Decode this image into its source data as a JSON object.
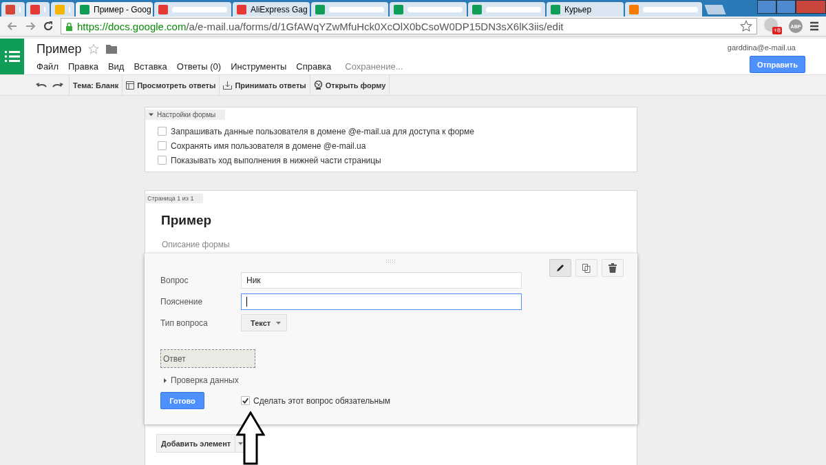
{
  "browser": {
    "tabs": [
      {
        "kind": "gmail",
        "selected": false
      },
      {
        "kind": "red",
        "selected": false
      },
      {
        "kind": "drive",
        "selected": false
      },
      {
        "kind": "forms",
        "title": "Пример - Goog",
        "selected": true
      },
      {
        "kind": "cart",
        "selected": false
      },
      {
        "kind": "cart",
        "title": "AliExpress Gag",
        "selected": false
      },
      {
        "kind": "sheets",
        "selected": false
      },
      {
        "kind": "sheets",
        "selected": false
      },
      {
        "kind": "sheets",
        "selected": false
      },
      {
        "kind": "sheets",
        "title": "Курьер",
        "selected": false
      },
      {
        "kind": "orange",
        "selected": false
      }
    ],
    "url_host": "https://docs.google.com",
    "url_path": "/a/e-mail.ua/forms/d/1GfAWqYZwMfuHck0XcOlX0bCsoW0DP15DN3sX6lK3iis/edit",
    "badge": "+8",
    "abp": "ABP"
  },
  "doc": {
    "title": "Пример",
    "starred": false,
    "account": "garddina@e-mail.ua",
    "send_button": "Отправить",
    "menu": [
      "Файл",
      "Правка",
      "Вид",
      "Вставка",
      "Ответы (0)",
      "Инструменты",
      "Справка"
    ],
    "save_status": "Сохранение..."
  },
  "toolbar": [
    {
      "kind": "theme",
      "label": "Тема: Бланк"
    },
    {
      "kind": "table",
      "label": "Просмотреть ответы"
    },
    {
      "kind": "download",
      "label": "Принимать ответы"
    },
    {
      "kind": "globe",
      "label": "Открыть форму"
    }
  ],
  "settings": {
    "title": "Настройки формы",
    "expanded": true,
    "options": [
      {
        "label": "Запрашивать данные пользователя в домене @e-mail.ua для доступа к форме",
        "checked": false
      },
      {
        "label": "Сохранять имя пользователя в домене @e-mail.ua",
        "checked": false
      },
      {
        "label": "Показывать ход выполнения в нижней части страницы",
        "checked": false
      }
    ]
  },
  "page": {
    "tab": "Страница 1 из 1",
    "title": "Пример",
    "description": "Описание формы"
  },
  "question": {
    "label_question": "Вопрос",
    "question": "Ник",
    "label_help": "Пояснение",
    "label_type": "Тип вопроса",
    "type": "Текст",
    "answer": "Ответ",
    "validation": "Проверка данных",
    "done": "Готово",
    "required_label": "Сделать этот вопрос обязательным",
    "required": true
  },
  "add_item": "Добавить элемент"
}
